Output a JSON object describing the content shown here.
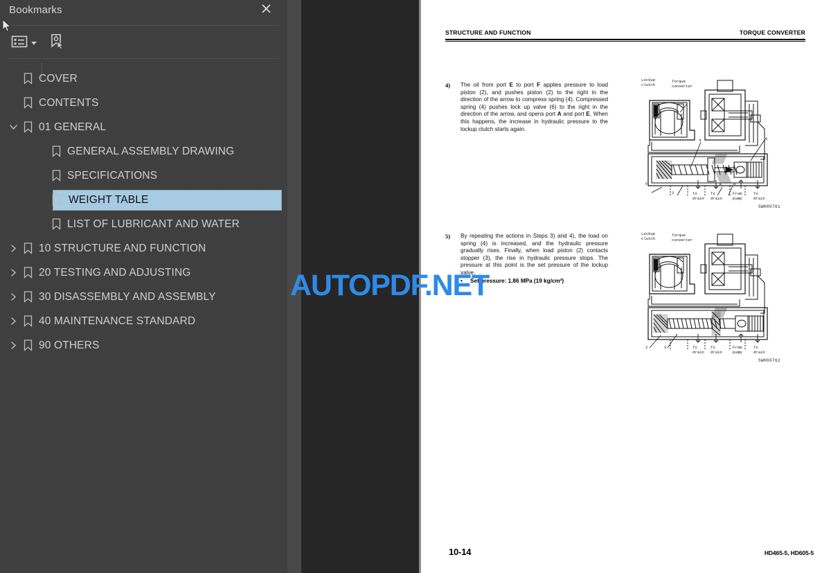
{
  "sidebar": {
    "title": "Bookmarks",
    "close_icon": "close-icon",
    "toolbar": {
      "options_label": "Bookmark options",
      "options_icon": "list-options-icon",
      "new_bookmark_label": "New bookmark",
      "new_bookmark_icon": "new-bookmark-icon",
      "caret_icon": "chevron-down-icon"
    },
    "items": [
      {
        "label": "COVER",
        "level": 0,
        "twisty": "none",
        "selected": false
      },
      {
        "label": "CONTENTS",
        "level": 0,
        "twisty": "none",
        "selected": false
      },
      {
        "label": "01 GENERAL",
        "level": 0,
        "twisty": "expanded",
        "selected": false
      },
      {
        "label": "GENERAL ASSEMBLY DRAWING",
        "level": 1,
        "twisty": "none",
        "selected": false
      },
      {
        "label": "SPECIFICATIONS",
        "level": 1,
        "twisty": "none",
        "selected": false
      },
      {
        "label": "WEIGHT TABLE",
        "level": 1,
        "twisty": "none",
        "selected": true
      },
      {
        "label": "LIST OF LUBRICANT AND WATER",
        "level": 1,
        "twisty": "none",
        "selected": false
      },
      {
        "label": "10 STRUCTURE AND FUNCTION",
        "level": 0,
        "twisty": "collapsed",
        "selected": false
      },
      {
        "label": "20 TESTING AND ADJUSTING",
        "level": 0,
        "twisty": "collapsed",
        "selected": false
      },
      {
        "label": "30 DISASSEMBLY AND ASSEMBLY",
        "level": 0,
        "twisty": "collapsed",
        "selected": false
      },
      {
        "label": "40 MAINTENANCE STANDARD",
        "level": 0,
        "twisty": "collapsed",
        "selected": false
      },
      {
        "label": "90 OTHERS",
        "level": 0,
        "twisty": "collapsed",
        "selected": false
      }
    ]
  },
  "watermark": {
    "text": "AUTOPDF.NET",
    "color": "#2f8ae8"
  },
  "page": {
    "header_left": "STRUCTURE AND FUNCTION",
    "header_right": "TORQUE CONVERTER",
    "page_number": "10-14",
    "model_codes": "HD465-5, HD605-5",
    "steps": [
      {
        "number": "4)",
        "text": "The oil from port E to port F applies pressure to load piston (2), and pushes piston (2) to the right in the direction of the arrow to compress spring (4). Compressed spring (4) pushes lock up valve (6) to the right in the direction of the arrow, and opens port A and port E. When this happens, the increase in hydraulic pressure to the lockup clutch starts again."
      },
      {
        "number": "5)",
        "text": "By repeating the actions in Steps 3) and 4), the load on spring (4) is increased, and the hydraulic pressure gradually rises. Finally, when load piston (2) contacts stopper (3), the rise in hydraulic pressure stops. The pressure at this point is the set pressure of the lockup valve.",
        "bullet": "Set pressure: 1.86 MPa (19 kg/cm²)"
      }
    ],
    "figures": [
      {
        "id": "SWH00761",
        "labels": [
          "Lockup\nclutch",
          "Torque\nconverter",
          "F",
          "2",
          "4",
          "6",
          "E",
          "A"
        ],
        "flow_labels": [
          "To\ndrain",
          "To\ndrain",
          "From\npump",
          "To\ndrain"
        ]
      },
      {
        "id": "SWH00762",
        "labels": [
          "Lockup\nclutch",
          "Torque\nconverter",
          "2",
          "3"
        ],
        "flow_labels": [
          "To\ndrain",
          "To\ndrain",
          "From\npump",
          "To\ndrain"
        ]
      }
    ]
  }
}
